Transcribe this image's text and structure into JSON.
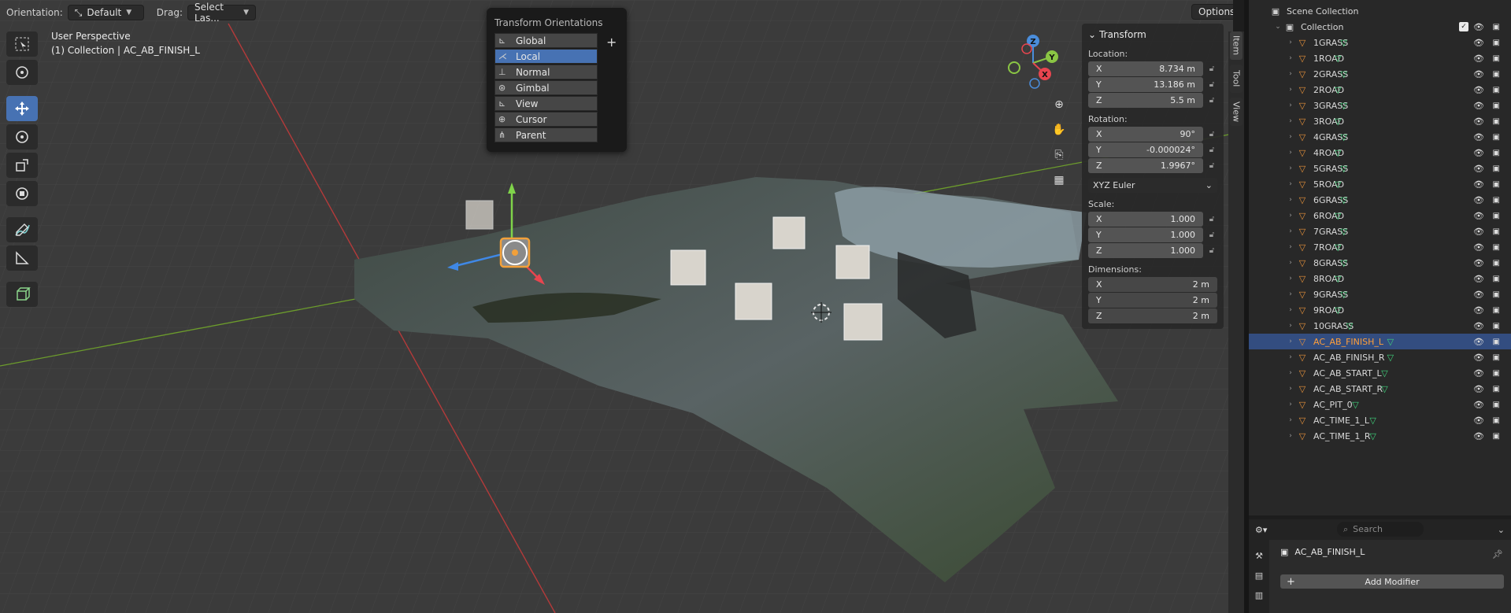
{
  "header": {
    "orientation_label": "Orientation:",
    "orientation_value": "Default",
    "drag_label": "Drag:",
    "drag_value": "Select Las...",
    "options_label": "Options"
  },
  "viewport_info": {
    "perspective": "User Perspective",
    "collection": "(1) Collection | AC_AB_FINISH_L"
  },
  "toolbar": {
    "tools": [
      "select-box-icon",
      "cursor-icon",
      "move-icon",
      "rotate-icon",
      "scale-icon",
      "transform-icon",
      "annotate-icon",
      "measure-icon",
      "add-cube-icon"
    ],
    "active_tool": "move-icon"
  },
  "transform_orientations": {
    "title": "Transform Orientations",
    "add_label": "+",
    "items": [
      {
        "label": "Global",
        "icon": "global-axes-icon"
      },
      {
        "label": "Local",
        "icon": "local-axes-icon",
        "selected": true
      },
      {
        "label": "Normal",
        "icon": "normal-axes-icon"
      },
      {
        "label": "Gimbal",
        "icon": "gimbal-icon"
      },
      {
        "label": "View",
        "icon": "view-axes-icon"
      },
      {
        "label": "Cursor",
        "icon": "cursor-axes-icon"
      },
      {
        "label": "Parent",
        "icon": "parent-axes-icon"
      }
    ]
  },
  "gizmo": {
    "x": "X",
    "y": "Y",
    "z": "Z",
    "x_color": "#e8454f",
    "y_color": "#8ac544",
    "z_color": "#4a8ddb"
  },
  "npanel": {
    "section": "Transform",
    "location_label": "Location:",
    "location": [
      {
        "axis": "X",
        "value": "8.734 m"
      },
      {
        "axis": "Y",
        "value": "13.186 m"
      },
      {
        "axis": "Z",
        "value": "5.5 m"
      }
    ],
    "rotation_label": "Rotation:",
    "rotation": [
      {
        "axis": "X",
        "value": "90°"
      },
      {
        "axis": "Y",
        "value": "-0.000024°"
      },
      {
        "axis": "Z",
        "value": "1.9967°"
      }
    ],
    "rotation_mode": "XYZ Euler",
    "scale_label": "Scale:",
    "scale": [
      {
        "axis": "X",
        "value": "1.000"
      },
      {
        "axis": "Y",
        "value": "1.000"
      },
      {
        "axis": "Z",
        "value": "1.000"
      }
    ],
    "dimensions_label": "Dimensions:",
    "dimensions": [
      {
        "axis": "X",
        "value": "2 m"
      },
      {
        "axis": "Y",
        "value": "2 m"
      },
      {
        "axis": "Z",
        "value": "2 m"
      }
    ]
  },
  "vtabs": [
    "Item",
    "Tool",
    "View"
  ],
  "outliner": {
    "scene_collection": "Scene Collection",
    "collection": "Collection",
    "items": [
      "1GRASS",
      "1ROAD",
      "2GRASS",
      "2ROAD",
      "3GRASS",
      "3ROAD",
      "4GRASS",
      "4ROAD",
      "5GRASS",
      "5ROAD",
      "6GRASS",
      "6ROAD",
      "7GRASS",
      "7ROAD",
      "8GRASS",
      "8ROAD",
      "9GRASS",
      "9ROAD",
      "10GRASS",
      "AC_AB_FINISH_L",
      "AC_AB_FINISH_R",
      "AC_AB_START_L",
      "AC_AB_START_R",
      "AC_PIT_0",
      "AC_TIME_1_L",
      "AC_TIME_1_R"
    ],
    "selected": "AC_AB_FINISH_L"
  },
  "properties": {
    "search_placeholder": "Search",
    "object_name": "AC_AB_FINISH_L",
    "add_modifier": "Add Modifier"
  },
  "colors": {
    "accent": "#4772b3",
    "selection_text": "#ff9f3a",
    "mesh_icon": "#e8923a",
    "vertex_icon": "#3fd27b"
  }
}
